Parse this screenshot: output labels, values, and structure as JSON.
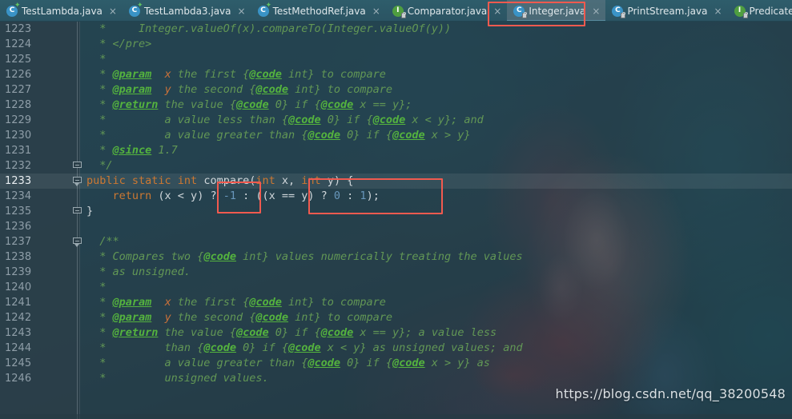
{
  "window": {
    "title": "Integer.java",
    "watermark": "https://blog.csdn.net/qq_38200548"
  },
  "tabs": [
    {
      "label": "TestLambda.java",
      "icon": "java-class-icon",
      "badge": "star",
      "active": false,
      "close": "×"
    },
    {
      "label": "TestLambda3.java",
      "icon": "java-class-icon",
      "badge": "star",
      "active": false,
      "close": "×"
    },
    {
      "label": "TestMethodRef.java",
      "icon": "java-class-icon",
      "badge": "star",
      "active": false,
      "close": "×"
    },
    {
      "label": "Comparator.java",
      "icon": "java-interface-icon",
      "badge": "lock",
      "active": false,
      "close": "×"
    },
    {
      "label": "Integer.java",
      "icon": "java-class-icon",
      "badge": "lock",
      "active": true,
      "close": "×"
    },
    {
      "label": "PrintStream.java",
      "icon": "java-class-icon",
      "badge": "lock",
      "active": false,
      "close": "×"
    },
    {
      "label": "Predicate.java",
      "icon": "java-interface-icon",
      "badge": "lock",
      "active": false,
      "close": ""
    }
  ],
  "icon_glyphs": {
    "java-class-icon": "C",
    "java-interface-icon": "I",
    "star-badge": "✦",
    "close-icon": "×"
  },
  "editor": {
    "caret_line": 1233,
    "first_visible_line": 1223,
    "last_visible_line": 1246,
    "lines": [
      {
        "no": 1223,
        "fold": "none",
        "tokens": [
          {
            "t": "doc",
            "s": "  *     Integer.valueOf(x).compareTo(Integer.valueOf(y))"
          }
        ]
      },
      {
        "no": 1224,
        "fold": "none",
        "tokens": [
          {
            "t": "doc",
            "s": "  * </pre>"
          }
        ]
      },
      {
        "no": 1225,
        "fold": "none",
        "tokens": [
          {
            "t": "doc",
            "s": "  *"
          }
        ]
      },
      {
        "no": 1226,
        "fold": "none",
        "tokens": [
          {
            "t": "doc",
            "s": "  * "
          },
          {
            "t": "tag",
            "s": "@param"
          },
          {
            "t": "doc",
            "s": "  "
          },
          {
            "t": "param",
            "s": "x"
          },
          {
            "t": "doc",
            "s": " the first {"
          },
          {
            "t": "tag",
            "s": "@code"
          },
          {
            "t": "doc",
            "s": " int} to compare"
          }
        ]
      },
      {
        "no": 1227,
        "fold": "none",
        "tokens": [
          {
            "t": "doc",
            "s": "  * "
          },
          {
            "t": "tag",
            "s": "@param"
          },
          {
            "t": "doc",
            "s": "  "
          },
          {
            "t": "param",
            "s": "y"
          },
          {
            "t": "doc",
            "s": " the second {"
          },
          {
            "t": "tag",
            "s": "@code"
          },
          {
            "t": "doc",
            "s": " int} to compare"
          }
        ]
      },
      {
        "no": 1228,
        "fold": "none",
        "tokens": [
          {
            "t": "doc",
            "s": "  * "
          },
          {
            "t": "tag",
            "s": "@return"
          },
          {
            "t": "doc",
            "s": " the value {"
          },
          {
            "t": "tag",
            "s": "@code"
          },
          {
            "t": "doc",
            "s": " 0} if {"
          },
          {
            "t": "tag",
            "s": "@code"
          },
          {
            "t": "doc",
            "s": " x == y};"
          }
        ]
      },
      {
        "no": 1229,
        "fold": "none",
        "tokens": [
          {
            "t": "doc",
            "s": "  *         a value less than {"
          },
          {
            "t": "tag",
            "s": "@code"
          },
          {
            "t": "doc",
            "s": " 0} if {"
          },
          {
            "t": "tag",
            "s": "@code"
          },
          {
            "t": "doc",
            "s": " x < y}; and"
          }
        ]
      },
      {
        "no": 1230,
        "fold": "none",
        "tokens": [
          {
            "t": "doc",
            "s": "  *         a value greater than {"
          },
          {
            "t": "tag",
            "s": "@code"
          },
          {
            "t": "doc",
            "s": " 0} if {"
          },
          {
            "t": "tag",
            "s": "@code"
          },
          {
            "t": "doc",
            "s": " x > y}"
          }
        ]
      },
      {
        "no": 1231,
        "fold": "none",
        "tokens": [
          {
            "t": "doc",
            "s": "  * "
          },
          {
            "t": "tag",
            "s": "@since"
          },
          {
            "t": "doc",
            "s": " 1.7"
          }
        ]
      },
      {
        "no": 1232,
        "fold": "box",
        "tokens": [
          {
            "t": "doc",
            "s": "  */"
          }
        ]
      },
      {
        "no": 1233,
        "fold": "tip",
        "tokens": [
          {
            "t": "kw",
            "s": "public static int "
          },
          {
            "t": "plain",
            "s": "compare"
          },
          {
            "t": "punct",
            "s": "("
          },
          {
            "t": "kw",
            "s": "int "
          },
          {
            "t": "plain",
            "s": "x"
          },
          {
            "t": "punct",
            "s": ", "
          },
          {
            "t": "kw",
            "s": "int "
          },
          {
            "t": "plain",
            "s": "y"
          },
          {
            "t": "punct",
            "s": ") {"
          }
        ]
      },
      {
        "no": 1234,
        "fold": "none",
        "tokens": [
          {
            "t": "plain",
            "s": "    "
          },
          {
            "t": "kw",
            "s": "return "
          },
          {
            "t": "punct",
            "s": "(x < y) ? "
          },
          {
            "t": "num",
            "s": "-1"
          },
          {
            "t": "punct",
            "s": " : ((x == y) ? "
          },
          {
            "t": "num",
            "s": "0"
          },
          {
            "t": "punct",
            "s": " : "
          },
          {
            "t": "num",
            "s": "1"
          },
          {
            "t": "punct",
            "s": ");"
          }
        ]
      },
      {
        "no": 1235,
        "fold": "box",
        "tokens": [
          {
            "t": "punct",
            "s": "}"
          }
        ]
      },
      {
        "no": 1236,
        "fold": "none",
        "tokens": [
          {
            "t": "plain",
            "s": ""
          }
        ]
      },
      {
        "no": 1237,
        "fold": "tip",
        "tokens": [
          {
            "t": "doc",
            "s": "  /**"
          }
        ]
      },
      {
        "no": 1238,
        "fold": "none",
        "tokens": [
          {
            "t": "doc",
            "s": "  * Compares two {"
          },
          {
            "t": "tag",
            "s": "@code"
          },
          {
            "t": "doc",
            "s": " int} values numerically treating the values"
          }
        ]
      },
      {
        "no": 1239,
        "fold": "none",
        "tokens": [
          {
            "t": "doc",
            "s": "  * as unsigned."
          }
        ]
      },
      {
        "no": 1240,
        "fold": "none",
        "tokens": [
          {
            "t": "doc",
            "s": "  *"
          }
        ]
      },
      {
        "no": 1241,
        "fold": "none",
        "tokens": [
          {
            "t": "doc",
            "s": "  * "
          },
          {
            "t": "tag",
            "s": "@param"
          },
          {
            "t": "doc",
            "s": "  "
          },
          {
            "t": "param",
            "s": "x"
          },
          {
            "t": "doc",
            "s": " the first {"
          },
          {
            "t": "tag",
            "s": "@code"
          },
          {
            "t": "doc",
            "s": " int} to compare"
          }
        ]
      },
      {
        "no": 1242,
        "fold": "none",
        "tokens": [
          {
            "t": "doc",
            "s": "  * "
          },
          {
            "t": "tag",
            "s": "@param"
          },
          {
            "t": "doc",
            "s": "  "
          },
          {
            "t": "param",
            "s": "y"
          },
          {
            "t": "doc",
            "s": " the second {"
          },
          {
            "t": "tag",
            "s": "@code"
          },
          {
            "t": "doc",
            "s": " int} to compare"
          }
        ]
      },
      {
        "no": 1243,
        "fold": "none",
        "tokens": [
          {
            "t": "doc",
            "s": "  * "
          },
          {
            "t": "tag",
            "s": "@return"
          },
          {
            "t": "doc",
            "s": " the value {"
          },
          {
            "t": "tag",
            "s": "@code"
          },
          {
            "t": "doc",
            "s": " 0} if {"
          },
          {
            "t": "tag",
            "s": "@code"
          },
          {
            "t": "doc",
            "s": " x == y}; a value less"
          }
        ]
      },
      {
        "no": 1244,
        "fold": "none",
        "tokens": [
          {
            "t": "doc",
            "s": "  *         than {"
          },
          {
            "t": "tag",
            "s": "@code"
          },
          {
            "t": "doc",
            "s": " 0} if {"
          },
          {
            "t": "tag",
            "s": "@code"
          },
          {
            "t": "doc",
            "s": " x < y} as unsigned values; and"
          }
        ]
      },
      {
        "no": 1245,
        "fold": "none",
        "tokens": [
          {
            "t": "doc",
            "s": "  *         a value greater than {"
          },
          {
            "t": "tag",
            "s": "@code"
          },
          {
            "t": "doc",
            "s": " 0} if {"
          },
          {
            "t": "tag",
            "s": "@code"
          },
          {
            "t": "doc",
            "s": " x > y} as"
          }
        ]
      },
      {
        "no": 1246,
        "fold": "none",
        "tokens": [
          {
            "t": "doc",
            "s": "  *         unsigned values."
          }
        ]
      }
    ]
  },
  "annotations": [
    {
      "name": "annotation-box-tab-integer",
      "target": "Integer.java tab"
    },
    {
      "name": "annotation-box-return-type",
      "target": "int"
    },
    {
      "name": "annotation-box-signature",
      "target": "(int x, int y) {"
    }
  ],
  "colors": {
    "accent_red": "#f15a4f",
    "javadoc_green": "#629755",
    "javadoc_tag_green": "#54b33e",
    "keyword_orange": "#cc7832",
    "number_blue": "#6897bb",
    "plain_text": "#cfd6da",
    "gutter_text": "#8f9ea8",
    "tab_bar_bg": "#2b5463",
    "active_tab_underline": "#5a8da0"
  }
}
